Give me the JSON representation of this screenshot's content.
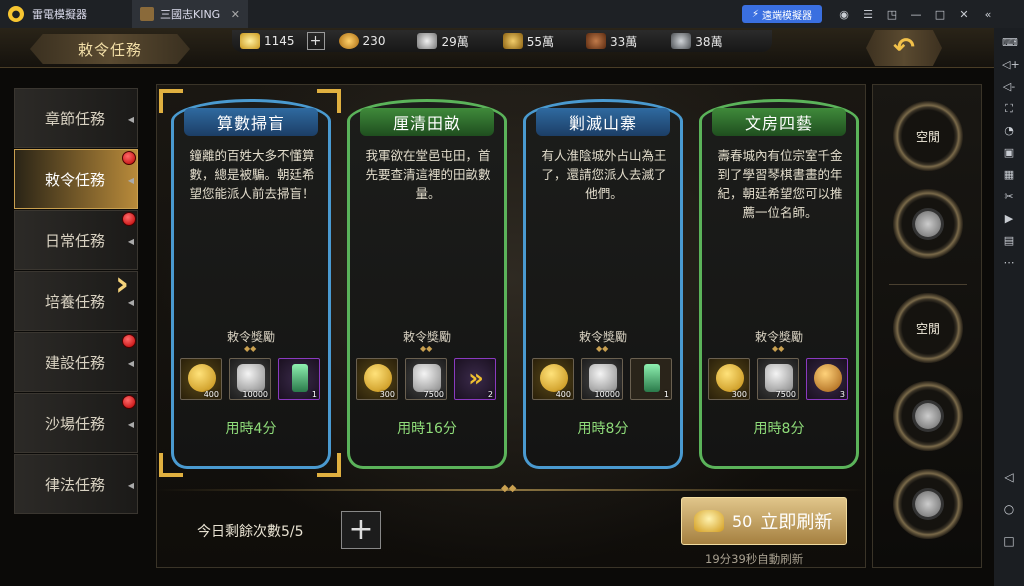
{
  "emulator": {
    "name": "雷電模擬器",
    "tab_title": "三國志KING",
    "remote_label": "遠端模擬器"
  },
  "header": {
    "title": "敕令任務",
    "resources": [
      {
        "icon": "gold-ingot-icon",
        "value": "1145",
        "color": "#e8c24a"
      },
      {
        "icon": "grain-sack-icon",
        "value": "230",
        "color": "#d9a23a"
      },
      {
        "icon": "silver-icon",
        "value": "29萬",
        "color": "#cfcfcf"
      },
      {
        "icon": "wheat-icon",
        "value": "55萬",
        "color": "#e0b24a"
      },
      {
        "icon": "wood-icon",
        "value": "33萬",
        "color": "#a0643a"
      },
      {
        "icon": "iron-icon",
        "value": "38萬",
        "color": "#9aa0a6"
      }
    ],
    "back_icon": "back-arrow-icon"
  },
  "nav": {
    "items": [
      {
        "label": "章節任務",
        "badge": false,
        "active": false
      },
      {
        "label": "敕令任務",
        "badge": true,
        "active": true
      },
      {
        "label": "日常任務",
        "badge": true,
        "active": false
      },
      {
        "label": "培養任務",
        "badge": false,
        "active": false
      },
      {
        "label": "建設任務",
        "badge": true,
        "active": false
      },
      {
        "label": "沙場任務",
        "badge": true,
        "active": false
      },
      {
        "label": "律法任務",
        "badge": false,
        "active": false
      }
    ]
  },
  "cards": [
    {
      "title": "算數掃盲",
      "border": "blue",
      "desc": "鐘離的百姓大多不懂算數，總是被騙。朝廷希望您能派人前去掃盲！",
      "reward_label": "敕令獎勵",
      "items": [
        {
          "type": "gold",
          "icon": "coin-icon",
          "count": "400"
        },
        {
          "type": "silver",
          "icon": "silver-pile-icon",
          "count": "10000"
        },
        {
          "type": "purple",
          "icon": "jade-token-icon",
          "count": "1"
        }
      ],
      "time": "用時4分"
    },
    {
      "title": "厘清田畝",
      "border": "green",
      "desc": "我軍欲在堂邑屯田，首先要查清這裡的田畝數量。",
      "reward_label": "敕令獎勵",
      "items": [
        {
          "type": "gold",
          "icon": "coin-icon",
          "count": "300"
        },
        {
          "type": "silver",
          "icon": "silver-pile-icon",
          "count": "7500"
        },
        {
          "type": "purple",
          "icon": "speedup-arrow-icon",
          "count": "2"
        }
      ],
      "time": "用時16分"
    },
    {
      "title": "剿滅山寨",
      "border": "blue",
      "desc": "有人淮陰城外占山為王了，還請您派人去滅了他們。",
      "reward_label": "敕令獎勵",
      "items": [
        {
          "type": "gold",
          "icon": "coin-icon",
          "count": "400"
        },
        {
          "type": "silver",
          "icon": "silver-pile-icon",
          "count": "10000"
        },
        {
          "type": "plain",
          "icon": "jade-token-icon",
          "count": "1"
        }
      ],
      "time": "用時8分"
    },
    {
      "title": "文房四藝",
      "border": "green",
      "desc": "壽春城內有位宗室千金到了學習琴棋書畫的年紀，朝廷希望您可以推薦一位名師。",
      "reward_label": "敕令獎勵",
      "items": [
        {
          "type": "gold",
          "icon": "coin-icon",
          "count": "300"
        },
        {
          "type": "silver",
          "icon": "silver-pile-icon",
          "count": "7500"
        },
        {
          "type": "purple",
          "icon": "golden-orb-icon",
          "count": "3"
        }
      ],
      "time": "用時8分"
    }
  ],
  "footer": {
    "remaining": "今日剩餘次數5/5",
    "refresh_cost": "50",
    "refresh_label": "立即刷新",
    "auto_refresh": "19分39秒自動刷新"
  },
  "slots": [
    {
      "state": "open",
      "label": "空閒"
    },
    {
      "state": "locked",
      "label": ""
    },
    {
      "state": "open",
      "label": "空閒"
    },
    {
      "state": "locked",
      "label": ""
    },
    {
      "state": "locked",
      "label": ""
    }
  ]
}
